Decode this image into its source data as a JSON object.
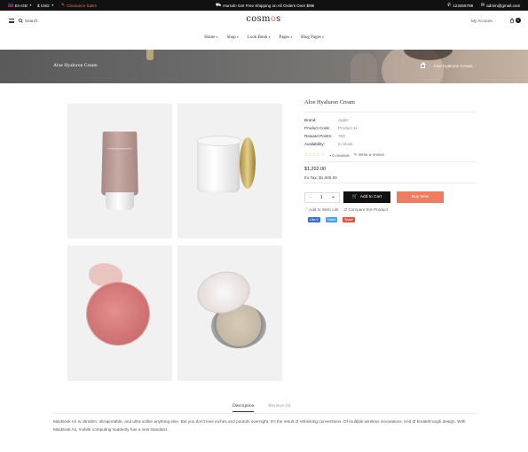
{
  "topbar": {
    "language": "En-GB",
    "currency": "$ USD",
    "clearance": "Clearance Sales",
    "promo": "Hurrah! Get Free Shipping on All Orders Over $99!",
    "phone": "123456789",
    "email": "admin@gmail.com"
  },
  "header": {
    "search_label": "Search",
    "logo_left": "cosm",
    "logo_accent": "o",
    "logo_right": "s",
    "account_label": "My Account",
    "cart_count": "0"
  },
  "nav": {
    "items": [
      {
        "label": "Home"
      },
      {
        "label": "Shop"
      },
      {
        "label": "Look Book"
      },
      {
        "label": "Pages"
      },
      {
        "label": "Blog Pages"
      }
    ]
  },
  "banner": {
    "title": "Aloe Hyaluron Cream",
    "breadcrumb_current": "Aloe Hyaluron Cream"
  },
  "product": {
    "title": "Aloe Hyaluron Cream",
    "specs": [
      {
        "key": "Brand:",
        "value": "Apple"
      },
      {
        "key": "Product Code:",
        "value": "Product 11"
      },
      {
        "key": "Reward Points:",
        "value": "700"
      },
      {
        "key": "Availability:",
        "value": "In Stock"
      }
    ],
    "rating": 0,
    "stars": "☆☆☆☆☆",
    "reviews": "0 reviews",
    "write_review": "Write a review",
    "price": "$1,202.00",
    "ex_tax": "Ex Tax: $1,000.00",
    "quantity": "1",
    "qty_minus": "-",
    "qty_plus": "+",
    "add_to_cart": "Add to Cart",
    "buy_now": "Buy Now",
    "wish_list": "Add to Wish List",
    "compare": "Compare this Product",
    "share": {
      "fb": "Like 0",
      "tw": "Tweet",
      "sh": "Share"
    }
  },
  "tabs": [
    {
      "label": "Description",
      "active": true
    },
    {
      "label": "Reviews (0)",
      "active": false
    }
  ],
  "description": "MacBook Air is ultrathin, ultraportable, and ultra unlike anything else. But you don’t lose inches and pounds overnight. It’s the result of rethinking conventions. Of multiple wireless innovations. And of breakthrough design. With MacBook Air, mobile computing suddenly has a new standard.",
  "colors": {
    "accent": "#f26b4f",
    "buy_now": "#f07c5f",
    "topbar": "#111111",
    "star": "#e6a35c"
  }
}
